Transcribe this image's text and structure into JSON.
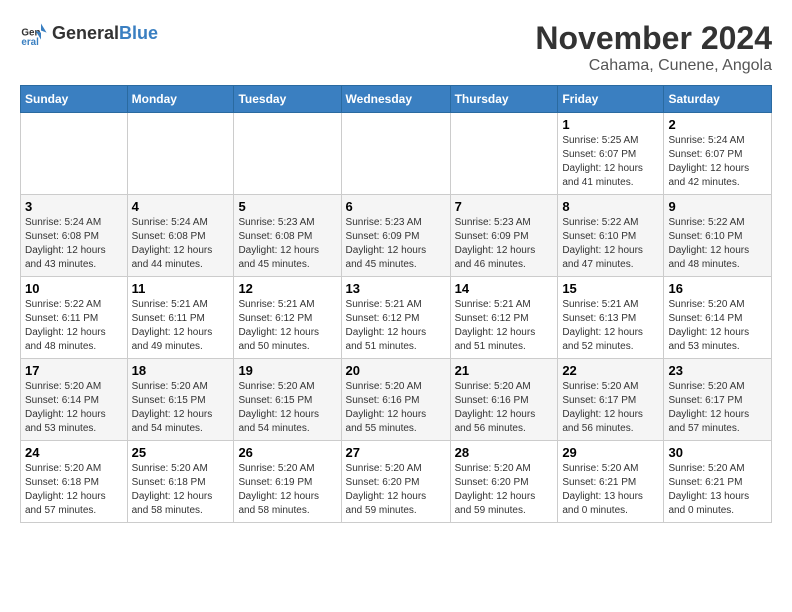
{
  "header": {
    "logo_line1": "General",
    "logo_line2": "Blue",
    "month": "November 2024",
    "location": "Cahama, Cunene, Angola"
  },
  "weekdays": [
    "Sunday",
    "Monday",
    "Tuesday",
    "Wednesday",
    "Thursday",
    "Friday",
    "Saturday"
  ],
  "weeks": [
    [
      {
        "day": "",
        "info": ""
      },
      {
        "day": "",
        "info": ""
      },
      {
        "day": "",
        "info": ""
      },
      {
        "day": "",
        "info": ""
      },
      {
        "day": "",
        "info": ""
      },
      {
        "day": "1",
        "info": "Sunrise: 5:25 AM\nSunset: 6:07 PM\nDaylight: 12 hours and 41 minutes."
      },
      {
        "day": "2",
        "info": "Sunrise: 5:24 AM\nSunset: 6:07 PM\nDaylight: 12 hours and 42 minutes."
      }
    ],
    [
      {
        "day": "3",
        "info": "Sunrise: 5:24 AM\nSunset: 6:08 PM\nDaylight: 12 hours and 43 minutes."
      },
      {
        "day": "4",
        "info": "Sunrise: 5:24 AM\nSunset: 6:08 PM\nDaylight: 12 hours and 44 minutes."
      },
      {
        "day": "5",
        "info": "Sunrise: 5:23 AM\nSunset: 6:08 PM\nDaylight: 12 hours and 45 minutes."
      },
      {
        "day": "6",
        "info": "Sunrise: 5:23 AM\nSunset: 6:09 PM\nDaylight: 12 hours and 45 minutes."
      },
      {
        "day": "7",
        "info": "Sunrise: 5:23 AM\nSunset: 6:09 PM\nDaylight: 12 hours and 46 minutes."
      },
      {
        "day": "8",
        "info": "Sunrise: 5:22 AM\nSunset: 6:10 PM\nDaylight: 12 hours and 47 minutes."
      },
      {
        "day": "9",
        "info": "Sunrise: 5:22 AM\nSunset: 6:10 PM\nDaylight: 12 hours and 48 minutes."
      }
    ],
    [
      {
        "day": "10",
        "info": "Sunrise: 5:22 AM\nSunset: 6:11 PM\nDaylight: 12 hours and 48 minutes."
      },
      {
        "day": "11",
        "info": "Sunrise: 5:21 AM\nSunset: 6:11 PM\nDaylight: 12 hours and 49 minutes."
      },
      {
        "day": "12",
        "info": "Sunrise: 5:21 AM\nSunset: 6:12 PM\nDaylight: 12 hours and 50 minutes."
      },
      {
        "day": "13",
        "info": "Sunrise: 5:21 AM\nSunset: 6:12 PM\nDaylight: 12 hours and 51 minutes."
      },
      {
        "day": "14",
        "info": "Sunrise: 5:21 AM\nSunset: 6:12 PM\nDaylight: 12 hours and 51 minutes."
      },
      {
        "day": "15",
        "info": "Sunrise: 5:21 AM\nSunset: 6:13 PM\nDaylight: 12 hours and 52 minutes."
      },
      {
        "day": "16",
        "info": "Sunrise: 5:20 AM\nSunset: 6:14 PM\nDaylight: 12 hours and 53 minutes."
      }
    ],
    [
      {
        "day": "17",
        "info": "Sunrise: 5:20 AM\nSunset: 6:14 PM\nDaylight: 12 hours and 53 minutes."
      },
      {
        "day": "18",
        "info": "Sunrise: 5:20 AM\nSunset: 6:15 PM\nDaylight: 12 hours and 54 minutes."
      },
      {
        "day": "19",
        "info": "Sunrise: 5:20 AM\nSunset: 6:15 PM\nDaylight: 12 hours and 54 minutes."
      },
      {
        "day": "20",
        "info": "Sunrise: 5:20 AM\nSunset: 6:16 PM\nDaylight: 12 hours and 55 minutes."
      },
      {
        "day": "21",
        "info": "Sunrise: 5:20 AM\nSunset: 6:16 PM\nDaylight: 12 hours and 56 minutes."
      },
      {
        "day": "22",
        "info": "Sunrise: 5:20 AM\nSunset: 6:17 PM\nDaylight: 12 hours and 56 minutes."
      },
      {
        "day": "23",
        "info": "Sunrise: 5:20 AM\nSunset: 6:17 PM\nDaylight: 12 hours and 57 minutes."
      }
    ],
    [
      {
        "day": "24",
        "info": "Sunrise: 5:20 AM\nSunset: 6:18 PM\nDaylight: 12 hours and 57 minutes."
      },
      {
        "day": "25",
        "info": "Sunrise: 5:20 AM\nSunset: 6:18 PM\nDaylight: 12 hours and 58 minutes."
      },
      {
        "day": "26",
        "info": "Sunrise: 5:20 AM\nSunset: 6:19 PM\nDaylight: 12 hours and 58 minutes."
      },
      {
        "day": "27",
        "info": "Sunrise: 5:20 AM\nSunset: 6:20 PM\nDaylight: 12 hours and 59 minutes."
      },
      {
        "day": "28",
        "info": "Sunrise: 5:20 AM\nSunset: 6:20 PM\nDaylight: 12 hours and 59 minutes."
      },
      {
        "day": "29",
        "info": "Sunrise: 5:20 AM\nSunset: 6:21 PM\nDaylight: 13 hours and 0 minutes."
      },
      {
        "day": "30",
        "info": "Sunrise: 5:20 AM\nSunset: 6:21 PM\nDaylight: 13 hours and 0 minutes."
      }
    ]
  ]
}
